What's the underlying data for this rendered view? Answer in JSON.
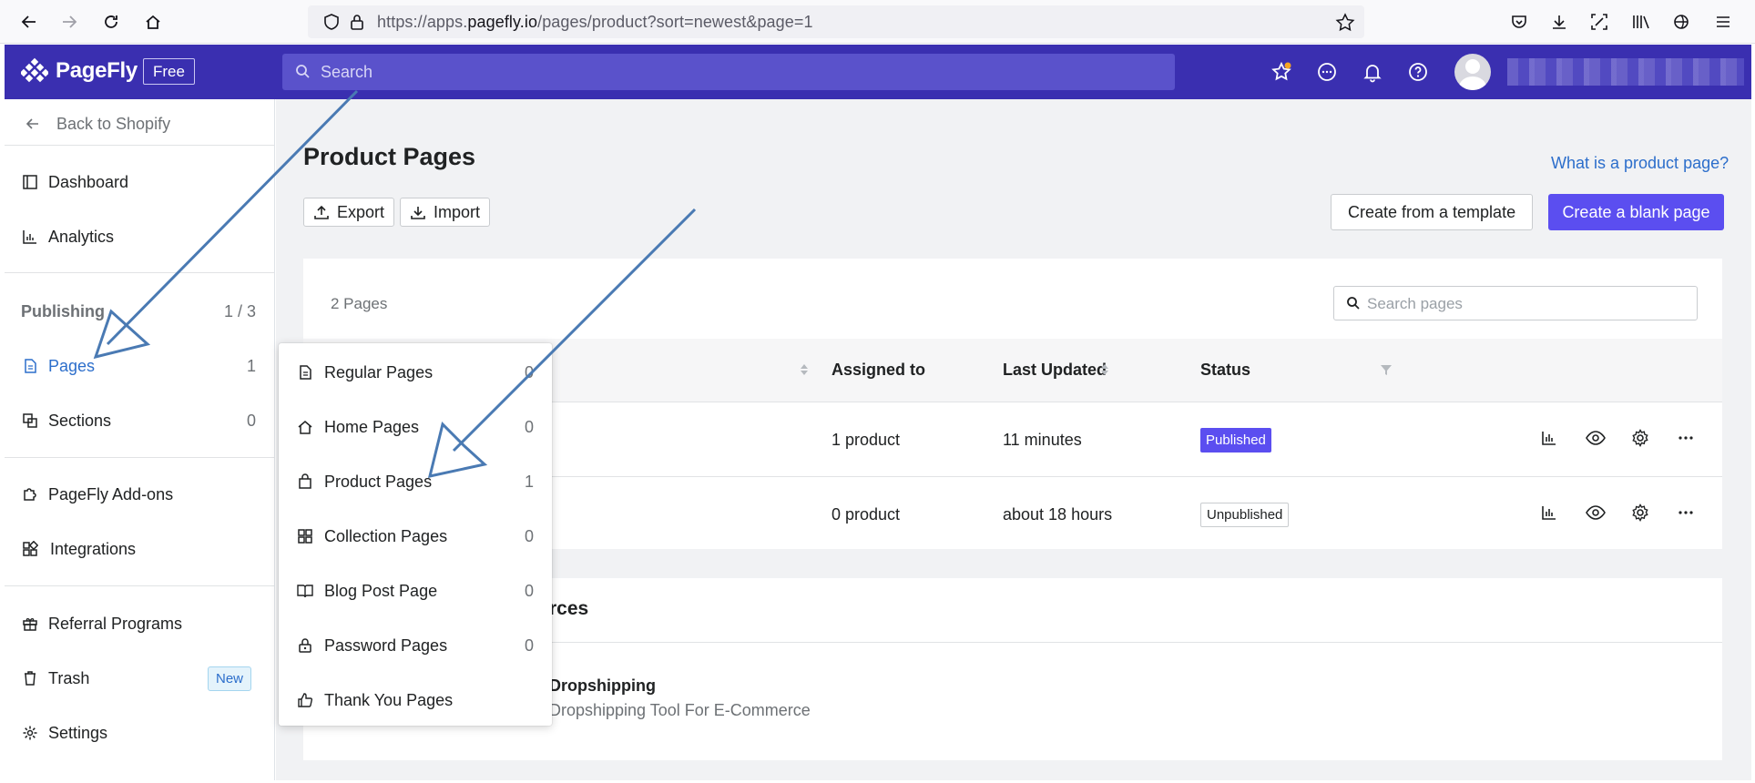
{
  "browser": {
    "url_prefix": "https://apps.",
    "url_domain": "pagefly.io",
    "url_path": "/pages/product?sort=newest&page=1"
  },
  "header": {
    "logo_name": "PageFly",
    "plan_badge": "Free",
    "search_placeholder": "Search"
  },
  "sidebar": {
    "back_label": "Back to Shopify",
    "dashboard": "Dashboard",
    "analytics": "Analytics",
    "publishing_label": "Publishing",
    "publishing_count": "1 / 3",
    "pages": "Pages",
    "pages_count": "1",
    "sections": "Sections",
    "sections_count": "0",
    "addons": "PageFly Add-ons",
    "integrations": "Integrations",
    "referral": "Referral Programs",
    "trash": "Trash",
    "trash_badge": "New",
    "settings": "Settings"
  },
  "main": {
    "title": "Product Pages",
    "help_link": "What is a product page?",
    "export": "Export",
    "import": "Import",
    "create_template": "Create from a template",
    "create_blank": "Create a blank page",
    "pages_count": "2 Pages",
    "search_pages_placeholder": "Search pages",
    "columns": {
      "assigned": "Assigned to",
      "updated": "Last Updated",
      "status": "Status"
    },
    "rows": [
      {
        "assigned": "1 product",
        "updated": "11 minutes",
        "status": "Published"
      },
      {
        "assigned": "0 product",
        "updated": "about 18 hours",
        "status": "Unpublished"
      }
    ],
    "resources_title_partial": "rces",
    "resource_title_partial": "Dropshipping",
    "resource_sub_partial": "Dropshipping Tool For E-Commerce"
  },
  "dropdown": {
    "items": [
      {
        "label": "Regular Pages",
        "count": "0"
      },
      {
        "label": "Home Pages",
        "count": "0"
      },
      {
        "label": "Product Pages",
        "count": "1"
      },
      {
        "label": "Collection Pages",
        "count": "0"
      },
      {
        "label": "Blog Post Page",
        "count": "0"
      },
      {
        "label": "Password Pages",
        "count": "0"
      },
      {
        "label": "Thank You Pages",
        "count": ""
      }
    ]
  },
  "colors": {
    "header_bg": "#3a2fb0",
    "primary": "#5b4ef0",
    "link": "#2c6ecb",
    "annotation_arrow": "#4a7ab3"
  }
}
